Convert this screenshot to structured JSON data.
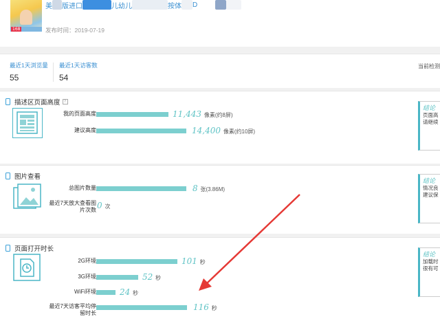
{
  "header": {
    "title_parts": [
      "美",
      "版进口",
      "儿幼儿",
      "按体",
      "D"
    ],
    "thumb_price": "168",
    "publish_label": "发布时间：",
    "publish_date": "2019-07-19"
  },
  "stats": {
    "views_label": "最近1天浏览量",
    "views_value": "55",
    "visitors_label": "最近1天访客数",
    "visitors_value": "54",
    "current_check": "当前检测"
  },
  "panels": {
    "height": {
      "title": "描述区页面高度",
      "help": "?",
      "metrics": [
        {
          "label": "我的页面高度",
          "value": "11,443",
          "unit": "像素(约8屏)",
          "fraction": 1.0
        },
        {
          "label": "建议高度",
          "value": "14,400",
          "unit": "像素(约10屏)",
          "fraction": 1.25
        }
      ],
      "conclusion": {
        "title": "结论",
        "lines": [
          "页面高",
          "请继续"
        ]
      }
    },
    "images": {
      "title": "图片查看",
      "metrics": [
        {
          "label": "总图片数量",
          "value": "8",
          "unit": "张(3.86M)",
          "fraction": 1.0
        },
        {
          "label": "最近7天放大查看图片次数",
          "value": "0",
          "unit": "次",
          "fraction": 0
        }
      ],
      "conclusion": {
        "title": "结论",
        "lines": [
          "情况良",
          "建议保"
        ]
      }
    },
    "load": {
      "title": "页面打开时长",
      "metrics": [
        {
          "label": "2G环境",
          "value": "101",
          "unit": "秒",
          "fraction": 0.87
        },
        {
          "label": "3G环境",
          "value": "52",
          "unit": "秒",
          "fraction": 0.45
        },
        {
          "label": "WiFi环境",
          "value": "24",
          "unit": "秒",
          "fraction": 0.21
        },
        {
          "label": "最近7天访客平均停留时长",
          "value": "116",
          "unit": "秒",
          "fraction": 1.0
        }
      ],
      "conclusion": {
        "title": "结论",
        "lines": [
          "加载时",
          "很有可"
        ]
      }
    }
  },
  "colors": {
    "accent": "#5fc3c5",
    "bar": "#7ccfcf",
    "link": "#3a8fd1",
    "arrow": "#e53935"
  }
}
